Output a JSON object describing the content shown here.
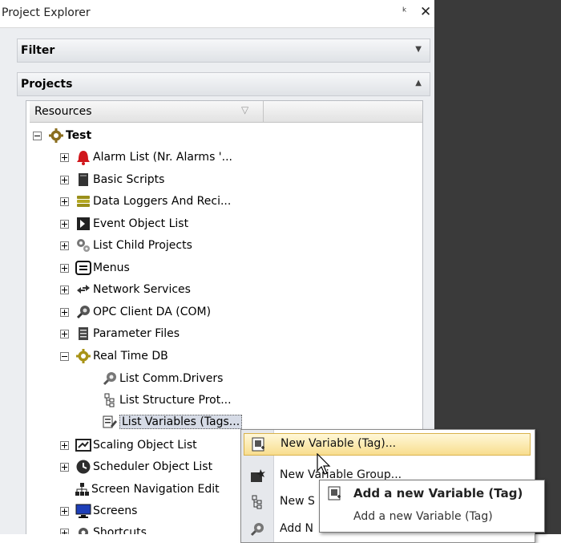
{
  "panel": {
    "title": "Project Explorer",
    "filter_label": "Filter",
    "projects_label": "Projects",
    "column_header": "Resources"
  },
  "tree": {
    "root": "Test",
    "items": [
      {
        "label": "Alarm List (Nr. Alarms '...",
        "icon": "alarm-bell-icon"
      },
      {
        "label": "Basic Scripts",
        "icon": "script-file-icon"
      },
      {
        "label": "Data Loggers And Reci...",
        "icon": "database-stack-icon"
      },
      {
        "label": "Event Object List",
        "icon": "event-object-icon"
      },
      {
        "label": "List Child Projects",
        "icon": "child-projects-icon"
      },
      {
        "label": "Menus",
        "icon": "menu-icon"
      },
      {
        "label": "Network Services",
        "icon": "network-arrows-icon"
      },
      {
        "label": "OPC Client DA (COM)",
        "icon": "opc-client-icon"
      },
      {
        "label": "Parameter Files",
        "icon": "parameter-files-icon"
      },
      {
        "label": "Real Time DB",
        "icon": "realtime-db-gear-icon"
      }
    ],
    "realtime_children": [
      {
        "label": "List Comm.Drivers",
        "icon": "comm-drivers-icon"
      },
      {
        "label": "List Structure Prot...",
        "icon": "structure-prototype-icon"
      },
      {
        "label": "List Variables (Tags...",
        "icon": "variables-tags-icon"
      }
    ],
    "after_items": [
      {
        "label": "Scaling Object List",
        "icon": "scaling-object-icon"
      },
      {
        "label": "Scheduler Object List",
        "icon": "scheduler-clock-icon"
      },
      {
        "label": "Screen Navigation Edit",
        "icon": "screen-navigation-icon"
      },
      {
        "label": "Screens",
        "icon": "screen-monitor-icon"
      },
      {
        "label": "Shortcuts",
        "icon": "shortcuts-gear-icon"
      }
    ]
  },
  "context_menu": {
    "items": [
      "New Variable (Tag)...",
      "New Variable Group...",
      "New S",
      "Add N"
    ]
  },
  "tooltip": {
    "title": "Add a new Variable (Tag)",
    "description": "Add a new Variable (Tag)"
  }
}
